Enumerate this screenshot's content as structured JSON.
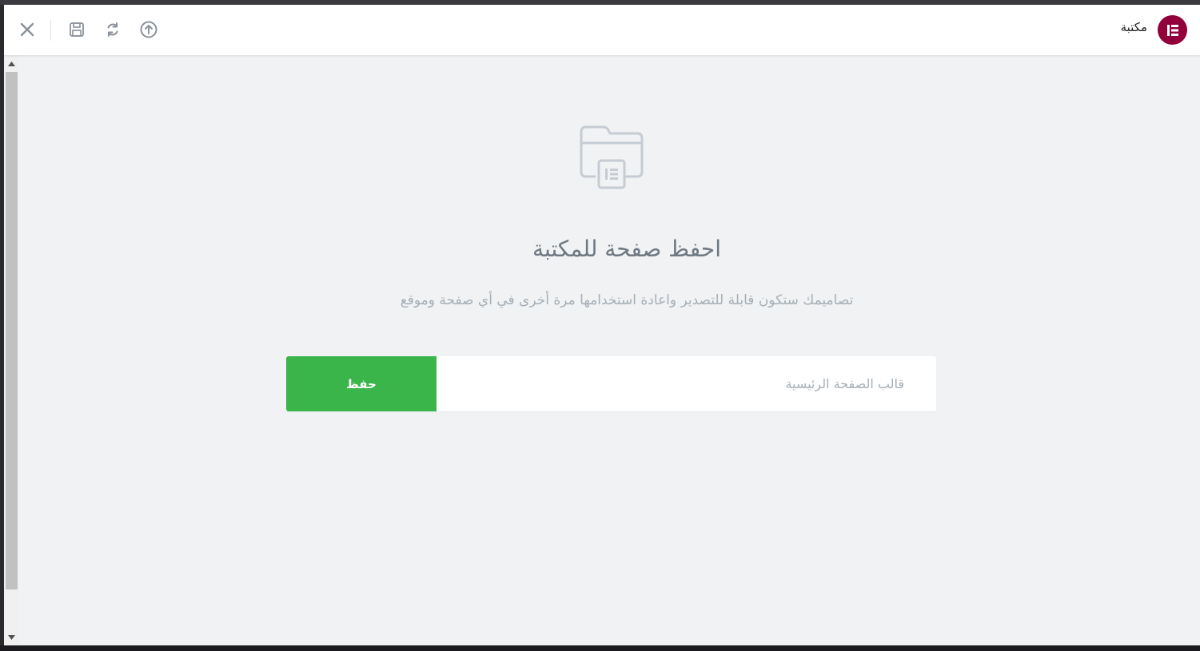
{
  "header": {
    "title": "مكتبة",
    "logo_icon": "elementor-logo-icon",
    "tools": [
      {
        "name": "close-icon",
        "label": "close"
      },
      {
        "name": "save-icon",
        "label": "save"
      },
      {
        "name": "sync-icon",
        "label": "sync"
      },
      {
        "name": "upload-icon",
        "label": "import"
      }
    ]
  },
  "empty_state": {
    "icon": "folder-template-icon",
    "title": "احفظ صفحة للمكتبة",
    "description": "تصاميمك ستكون قابلة للتصدير واعادة استخدامها مرة أخرى في أي صفحة وموقع"
  },
  "form": {
    "input_placeholder": "قالب الصفحة الرئيسية",
    "input_value": "",
    "save_label": "حفظ"
  },
  "colors": {
    "brand": "#92003b",
    "save_button": "#39b54a",
    "background": "#f1f2f4",
    "title_text": "#6d7882",
    "muted_text": "#a4afb7"
  }
}
